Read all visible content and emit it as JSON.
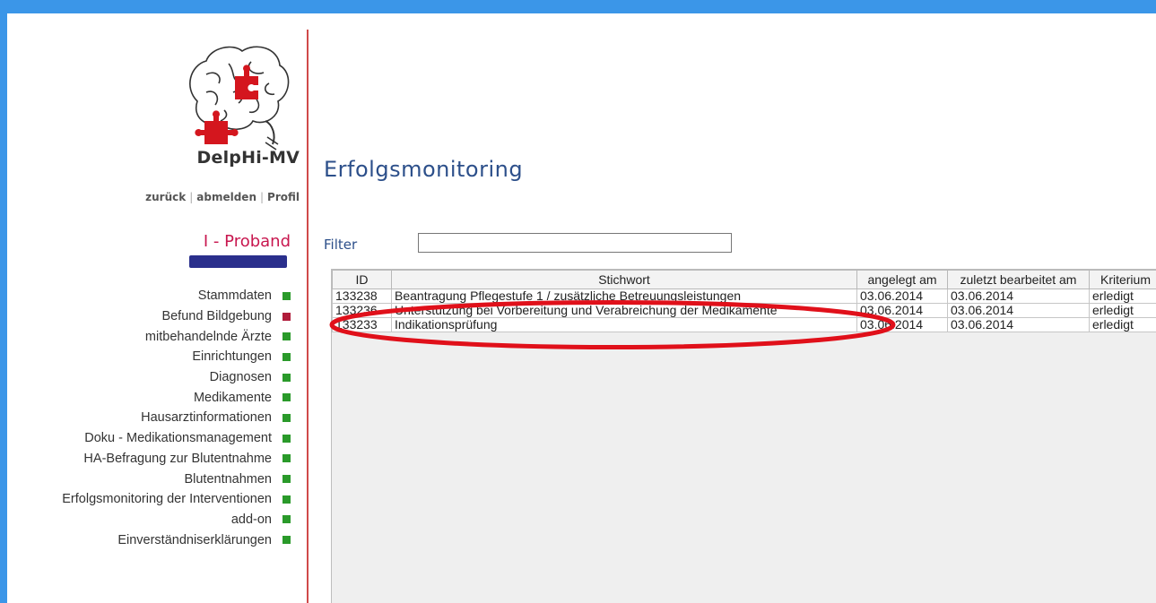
{
  "sidebar": {
    "brand": "DelpHi-MV",
    "links": {
      "back": "zurück",
      "logout": "abmelden",
      "profile": "Profil"
    },
    "section_title": "I - Proband",
    "items": [
      {
        "label": "Stammdaten",
        "status": "green"
      },
      {
        "label": "Befund Bildgebung",
        "status": "red"
      },
      {
        "label": "mitbehandelnde Ärzte",
        "status": "green"
      },
      {
        "label": "Einrichtungen",
        "status": "green"
      },
      {
        "label": "Diagnosen",
        "status": "green"
      },
      {
        "label": "Medikamente",
        "status": "green"
      },
      {
        "label": "Hausarztinformationen",
        "status": "green"
      },
      {
        "label": "Doku - Medikationsmanagement",
        "status": "green"
      },
      {
        "label": "HA-Befragung zur Blutentnahme",
        "status": "green"
      },
      {
        "label": "Blutentnahmen",
        "status": "green"
      },
      {
        "label": "Erfolgsmonitoring der Interventionen",
        "status": "green"
      },
      {
        "label": "add-on",
        "status": "green"
      },
      {
        "label": "Einverständniserklärungen",
        "status": "green"
      }
    ]
  },
  "main": {
    "title": "Erfolgsmonitoring",
    "filter": {
      "label": "Filter",
      "value": "",
      "placeholder": ""
    },
    "table": {
      "columns": [
        "ID",
        "Stichwort",
        "angelegt am",
        "zuletzt bearbeitet am",
        "Kriterium"
      ],
      "rows": [
        [
          "133238",
          "Beantragung Pflegestufe 1 / zusätzliche Betreuungsleistungen",
          "03.06.2014",
          "03.06.2014",
          "erledigt"
        ],
        [
          "133236",
          "Unterstützung bei Vorbereitung und Verabreichung der Medikamente",
          "03.06.2014",
          "03.06.2014",
          "erledigt"
        ],
        [
          "133233",
          "Indikationsprüfung",
          "03.06.2014",
          "03.06.2014",
          "erledigt"
        ]
      ]
    }
  },
  "colors": {
    "background_blue": "#3b96e8",
    "title_blue": "#2c4f8a",
    "accent_red": "#c8174f",
    "status_green": "#2a9a2a",
    "status_red": "#b01c3a",
    "highlight_ellipse": "#e0101a"
  },
  "icons": {
    "logo": "brain-puzzle-logo"
  }
}
